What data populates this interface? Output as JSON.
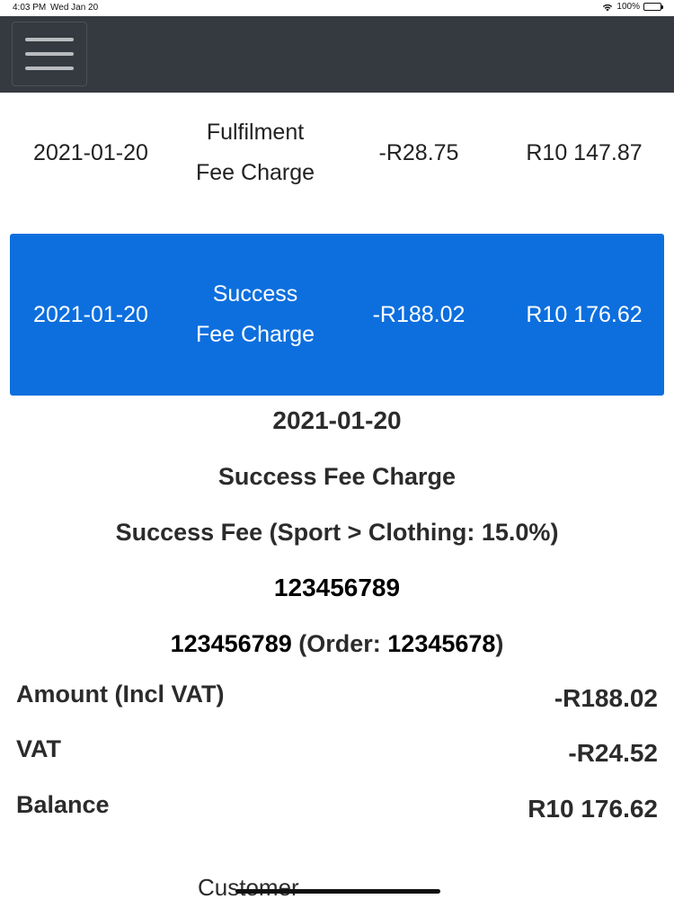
{
  "status_bar": {
    "time": "4:03 PM",
    "date": "Wed Jan 20",
    "battery": "100%"
  },
  "navbar": {
    "menu_icon": "hamburger-menu-icon",
    "background": "#343a40"
  },
  "transactions": [
    {
      "date": "2021-01-20",
      "type_line1": "Fulfilment",
      "type_line2": "Fee Charge",
      "amount": "-R28.75",
      "balance": "R10 147.87",
      "selected": false
    },
    {
      "date": "2021-01-20",
      "type_line1": "Success",
      "type_line2": "Fee Charge",
      "amount": "-R188.02",
      "balance": "R10 176.62",
      "selected": true
    }
  ],
  "detail": {
    "date": "2021-01-20",
    "type": "Success Fee Charge",
    "description": "Success Fee (Sport > Clothing: 15.0%)",
    "reference": "123456789",
    "order_prefix_number": "123456789",
    "order_label": "(Order:",
    "order_number": "12345678",
    "order_suffix": ")",
    "amount_label": "Amount (Incl VAT)",
    "amount_value": "-R188.02",
    "vat_label": "VAT",
    "vat_value": "-R24.52",
    "balance_label": "Balance",
    "balance_value": "R10 176.62"
  },
  "bottom": {
    "label": "Customer"
  },
  "colors": {
    "selected_row": "#0d6fde",
    "navbar": "#343a40"
  }
}
